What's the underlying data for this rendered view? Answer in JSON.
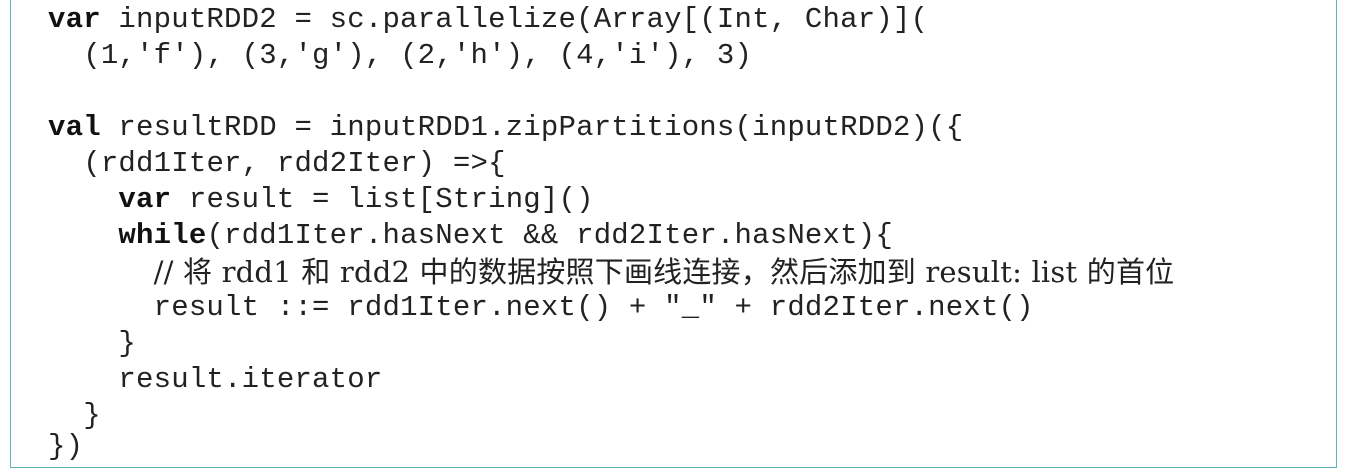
{
  "code": {
    "lines": [
      {
        "indent": "",
        "keyword": "var",
        "text": " inputRDD2 = sc.parallelize(Array[(Int, Char)]("
      },
      {
        "indent": "  ",
        "keyword": "",
        "text": "(1,'f'), (3,'g'), (2,'h'), (4,'i'), 3)"
      },
      {
        "indent": "",
        "keyword": "",
        "text": ""
      },
      {
        "indent": "",
        "keyword": "val",
        "text": " resultRDD = inputRDD1.zipPartitions(inputRDD2)({"
      },
      {
        "indent": "  ",
        "keyword": "",
        "text": "(rdd1Iter, rdd2Iter) =>{"
      },
      {
        "indent": "    ",
        "keyword": "var",
        "text": " result = list[String]()"
      },
      {
        "indent": "    ",
        "keyword": "while",
        "text": "(rdd1Iter.hasNext && rdd2Iter.hasNext){"
      },
      {
        "indent": "      ",
        "keyword": "",
        "text": "// 将 rdd1 和 rdd2 中的数据按照下画线连接，然后添加到 result: list 的首位"
      },
      {
        "indent": "      ",
        "keyword": "",
        "text": "result ::= rdd1Iter.next() + \"_\" + rdd2Iter.next()"
      },
      {
        "indent": "    ",
        "keyword": "",
        "text": "}"
      },
      {
        "indent": "    ",
        "keyword": "",
        "text": "result.iterator"
      },
      {
        "indent": "  ",
        "keyword": "",
        "text": "}"
      },
      {
        "indent": "",
        "keyword": "",
        "text": "})"
      }
    ]
  },
  "colors": {
    "border": "#5fb7bd",
    "text": "#222222"
  }
}
